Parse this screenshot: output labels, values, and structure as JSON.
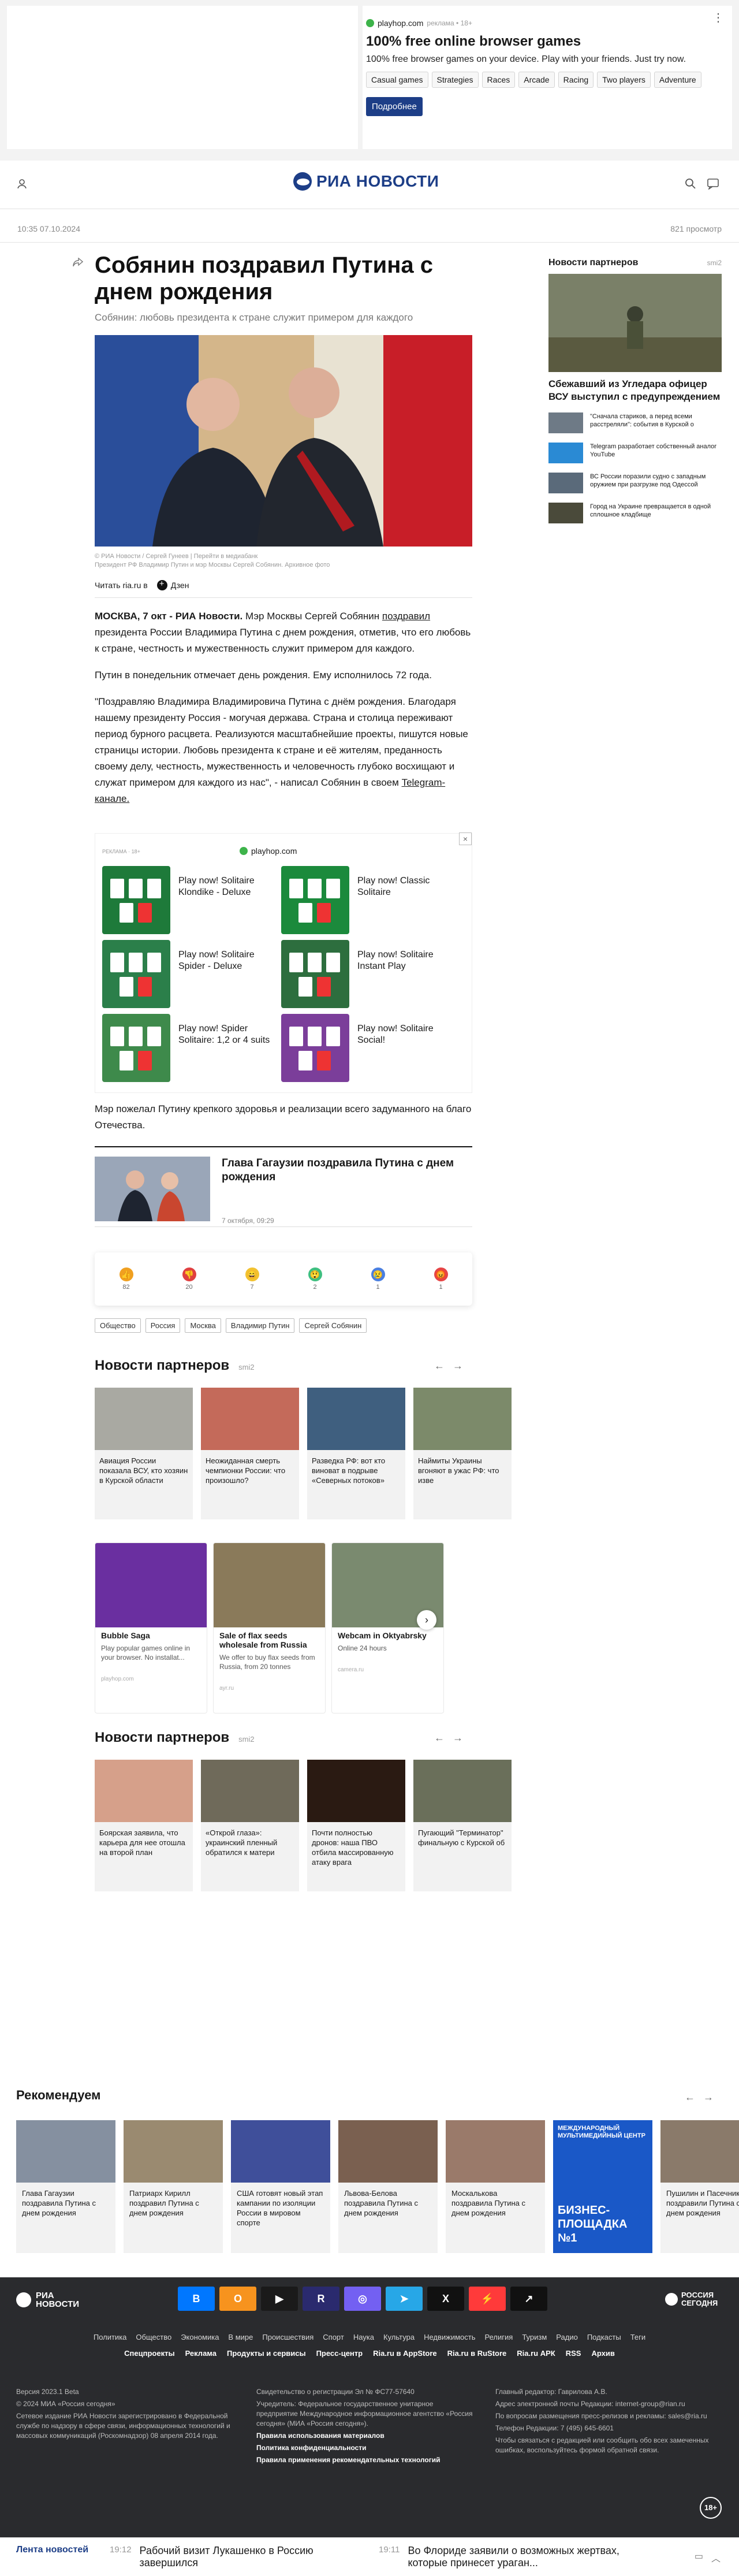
{
  "top_ad": {
    "site": "playhop.com",
    "label": "реклама • 18+",
    "title": "100% free online browser games",
    "text": "100% free browser games on your device. Play with your friends. Just try now.",
    "tags": [
      "Casual games",
      "Strategies",
      "Races",
      "Arcade",
      "Racing",
      "Two players",
      "Adventure"
    ],
    "button": "Подробнее"
  },
  "header": {
    "logo": "РИА НОВОСТИ"
  },
  "meta": {
    "datetime": "10:35 07.10.2024",
    "views": "821 просмотр"
  },
  "article": {
    "title": "Собянин поздравил Путина с днем рождения",
    "subtitle": "Собянин: любовь президента к стране служит примером для каждого",
    "caption_1": "© РИА Новости / Сергей Гунеев | Перейти в медиабанк",
    "caption_2": "Президент РФ Владимир Путин и мэр Москвы Сергей Собянин. Архивное фото",
    "read_label": "Читать ria.ru в",
    "dzen": "Дзен",
    "p1_lead": "МОСКВА, 7 окт - РИА Новости.",
    "p1_a": " Мэр Москвы Сергей Собянин ",
    "p1_link": "поздравил",
    "p1_b": " президента России Владимира Путина с днем рождения, отметив, что его любовь к стране, честность и мужественность служит примером для каждого.",
    "p2": "Путин в понедельник отмечает день рождения. Ему исполнилось 72 года.",
    "p3_a": "\"Поздравляю Владимира Владимировича Путина с днём рождения. Благодаря нашему президенту Россия - могучая держава. Страна и столица переживают период бурного расцвета. Реализуются масштабнейшие проекты, пишутся новые страницы истории. Любовь президента к стране и её жителям, преданность своему делу, честность, мужественность и человечность глубоко восхищают и служат примером для каждого из нас\", - написал Собянин в своем ",
    "p3_link": "Telegram-канале.",
    "p4": "Мэр пожелал Путину крепкого здоровья и реализации всего задуманного на благо Отечества."
  },
  "inline_ad": {
    "label": "РЕКЛАМА · 18+",
    "site": "playhop.com",
    "close": "×",
    "games": [
      {
        "title": "Play now! Solitaire Klondike - Deluxe",
        "color": "#1e7a3a"
      },
      {
        "title": "Play now! Classic Solitaire",
        "color": "#1b8a3c"
      },
      {
        "title": "Play now! Solitaire Spider - Deluxe",
        "color": "#2b7f4a"
      },
      {
        "title": "Play now! Solitaire Instant Play",
        "color": "#2d6e3e"
      },
      {
        "title": "Play now! Spider Solitaire: 1,2 or 4 suits",
        "color": "#3e8a4b"
      },
      {
        "title": "Play now! Solitaire Social!",
        "color": "#7b3e9a"
      }
    ]
  },
  "related": {
    "title": "Глава Гагаузии поздравила Путина с днем рождения",
    "date": "7 октября, 09:29"
  },
  "reactions": [
    {
      "icon": "👍",
      "count": "82",
      "color": "#f0a020"
    },
    {
      "icon": "👎",
      "count": "20",
      "color": "#e04040"
    },
    {
      "icon": "😄",
      "count": "7",
      "color": "#f2c230"
    },
    {
      "icon": "😲",
      "count": "2",
      "color": "#3fbf7f"
    },
    {
      "icon": "😢",
      "count": "1",
      "color": "#4a7fe0"
    },
    {
      "icon": "😡",
      "count": "1",
      "color": "#e64545"
    }
  ],
  "tags": [
    "Общество",
    "Россия",
    "Москва",
    "Владимир Путин",
    "Сергей Собянин"
  ],
  "partners1": {
    "title": "Новости партнеров",
    "source": "smi2",
    "items": [
      {
        "text": "Авиация России показала ВСУ, кто хозяин в Курской области",
        "color": "#a9a9a2"
      },
      {
        "text": "Неожиданная смерть чемпионки России: что произошло?",
        "color": "#c46a5a"
      },
      {
        "text": "Разведка РФ: вот кто виноват в подрыве «Северных потоков»",
        "color": "#3f5f7f"
      },
      {
        "text": "Наймиты Украины вгоняют в ужас РФ: что изве",
        "color": "#7c8a6a"
      }
    ]
  },
  "ad_games": [
    {
      "title": "Bubble Saga",
      "desc": "Play popular games online in your browser. No installat...",
      "foot": "playhop.com",
      "color": "#6a2fa0"
    },
    {
      "title": "Sale of flax seeds wholesale from Russia",
      "desc": "We offer to buy flax seeds from Russia, from 20 tonnes",
      "foot": "ayr.ru",
      "color": "#8a7a5a"
    },
    {
      "title": "Webcam in Oktyabrsky",
      "desc": "Online 24 hours",
      "foot": "camera.ru",
      "color": "#7a8a6f"
    }
  ],
  "partners2": {
    "title": "Новости партнеров",
    "source": "smi2",
    "items": [
      {
        "text": "Боярская заявила, что карьера для нее отошла на второй план",
        "color": "#d6a08a"
      },
      {
        "text": "«Открой глаза»: украинский пленный обратился к матери",
        "color": "#6f6a5a"
      },
      {
        "text": "Почти полностью дронов: наша ПВО отбила массированную атаку врага",
        "color": "#2a1a12"
      },
      {
        "text": "Пугающий \"Терминатор\" финальную с Курской об",
        "color": "#6a6f5a"
      }
    ]
  },
  "sidebar": {
    "title": "Новости партнеров",
    "source": "smi2",
    "big_title": "Сбежавший из Угледара офицер ВСУ выступил с предупреждением",
    "items": [
      {
        "text": "\"Сначала стариков, а перед всеми расстреляли\": события в Курской о",
        "color": "#6e7a86"
      },
      {
        "text": "Telegram разработает собственный аналог YouTube",
        "color": "#2a8ad4"
      },
      {
        "text": "ВС России поразили судно с западным оружием при разгрузке под Одессой",
        "color": "#5a6a7a"
      },
      {
        "text": "Город на Украине превращается в одной сплошное кладбище",
        "color": "#4a4a3a"
      }
    ]
  },
  "recommended": {
    "title": "Рекомендуем",
    "items": [
      {
        "text": "Глава Гагаузии поздравила Путина с днем рождения",
        "color": "#8590a0"
      },
      {
        "text": "Патриарх Кирилл поздравил Путина с днем рождения",
        "color": "#9a8a70"
      },
      {
        "text": "США готовят новый этап кампании по изоляции России в мировом спорте",
        "color": "#3f4f9a"
      },
      {
        "text": "Львова-Белова поздравила Путина с днем рождения",
        "color": "#7a6050"
      },
      {
        "text": "Москалькова поздравила Путина с днем рождения",
        "color": "#9a7a6a"
      },
      {
        "text": "Пушилин и Пасечник поздравили Путина с днем рождения",
        "color": "#8a7a6a"
      }
    ],
    "ad_text": "БИЗНЕС-ПЛОЩАДКА №1",
    "ad_top": "МЕЖДУНАРОДНЫЙ МУЛЬТИМЕДИЙНЫЙ ЦЕНТР"
  },
  "footer": {
    "logo": "РИА НОВОСТИ",
    "rs": "РОССИЯ СЕГОДНЯ",
    "social": [
      {
        "icon": "В",
        "color": "#0077ff"
      },
      {
        "icon": "О",
        "color": "#f7931e"
      },
      {
        "icon": "▶",
        "color": "#1a1a1a"
      },
      {
        "icon": "R",
        "color": "#2a2a6e"
      },
      {
        "icon": "◎",
        "color": "#7360f2"
      },
      {
        "icon": "➤",
        "color": "#27a7e7"
      },
      {
        "icon": "X",
        "color": "#111111"
      },
      {
        "icon": "⚡",
        "color": "#ff3a3a"
      },
      {
        "icon": "↗",
        "color": "#111111"
      }
    ],
    "nav": [
      "Политика",
      "Общество",
      "Экономика",
      "В мире",
      "Происшествия",
      "Спорт",
      "Наука",
      "Культура",
      "Недвижимость",
      "Религия",
      "Туризм",
      "Радио",
      "Подкасты",
      "Теги"
    ],
    "nav2": [
      "Спецпроекты",
      "Реклама",
      "Продукты и сервисы",
      "Пресс-центр",
      "Ria.ru в AppStore",
      "Ria.ru в RuStore",
      "Ria.ru АРК",
      "RSS",
      "Архив"
    ],
    "col1": [
      "Версия 2023.1 Beta",
      "© 2024 МИА «Россия сегодня»",
      "Сетевое издание РИА Новости зарегистрировано в Федеральной службе по надзору в сфере связи, информационных технологий и массовых коммуникаций (Роскомнадзор) 08 апреля 2014 года."
    ],
    "col2": [
      "Свидетельство о регистрации Эл № ФС77-57640",
      "Учредитель: Федеральное государственное унитарное предприятие Международное информационное агентство «Россия сегодня» (МИА «Россия сегодня»)."
    ],
    "col2b": [
      "Правила использования материалов",
      "Политика конфиденциальности",
      "Правила применения рекомендательных технологий"
    ],
    "col3": [
      "Главный редактор: Гаврилова А.В.",
      "Адрес электронной почты Редакции: internet-group@rian.ru",
      "По вопросам размещения пресс-релизов и рекламы: sales@ria.ru",
      "Телефон Редакции: 7 (495) 645-6601",
      "Чтобы связаться с редакцией или сообщить обо всех замеченных ошибках, воспользуйтесь формой обратной связи."
    ],
    "age": "18+"
  },
  "bottom_bar": {
    "label": "Лента новостей",
    "n1_time": "19:12",
    "n1_text": "Рабочий визит Лукашенко в Россию завершился",
    "n2_time": "19:11",
    "n2_text": "Во Флориде заявили о возможных жертвах, которые принесет урагaн..."
  }
}
